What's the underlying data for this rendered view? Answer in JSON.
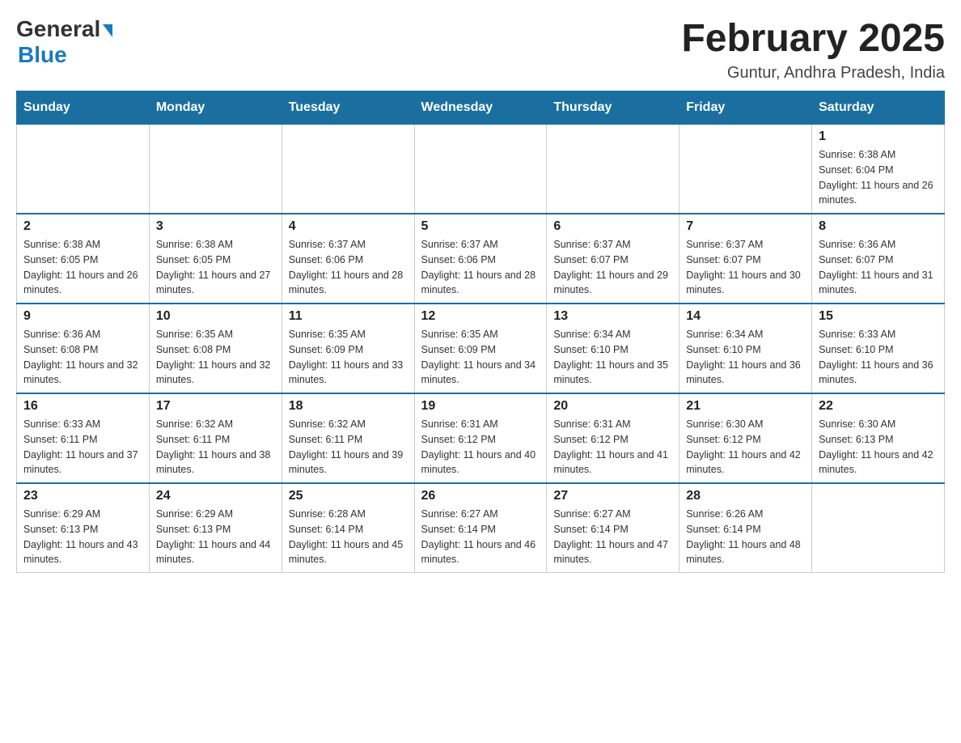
{
  "header": {
    "logo_general": "General",
    "logo_blue": "Blue",
    "month_title": "February 2025",
    "location": "Guntur, Andhra Pradesh, India"
  },
  "weekdays": [
    "Sunday",
    "Monday",
    "Tuesday",
    "Wednesday",
    "Thursday",
    "Friday",
    "Saturday"
  ],
  "weeks": [
    [
      {
        "day": "",
        "sunrise": "",
        "sunset": "",
        "daylight": ""
      },
      {
        "day": "",
        "sunrise": "",
        "sunset": "",
        "daylight": ""
      },
      {
        "day": "",
        "sunrise": "",
        "sunset": "",
        "daylight": ""
      },
      {
        "day": "",
        "sunrise": "",
        "sunset": "",
        "daylight": ""
      },
      {
        "day": "",
        "sunrise": "",
        "sunset": "",
        "daylight": ""
      },
      {
        "day": "",
        "sunrise": "",
        "sunset": "",
        "daylight": ""
      },
      {
        "day": "1",
        "sunrise": "Sunrise: 6:38 AM",
        "sunset": "Sunset: 6:04 PM",
        "daylight": "Daylight: 11 hours and 26 minutes."
      }
    ],
    [
      {
        "day": "2",
        "sunrise": "Sunrise: 6:38 AM",
        "sunset": "Sunset: 6:05 PM",
        "daylight": "Daylight: 11 hours and 26 minutes."
      },
      {
        "day": "3",
        "sunrise": "Sunrise: 6:38 AM",
        "sunset": "Sunset: 6:05 PM",
        "daylight": "Daylight: 11 hours and 27 minutes."
      },
      {
        "day": "4",
        "sunrise": "Sunrise: 6:37 AM",
        "sunset": "Sunset: 6:06 PM",
        "daylight": "Daylight: 11 hours and 28 minutes."
      },
      {
        "day": "5",
        "sunrise": "Sunrise: 6:37 AM",
        "sunset": "Sunset: 6:06 PM",
        "daylight": "Daylight: 11 hours and 28 minutes."
      },
      {
        "day": "6",
        "sunrise": "Sunrise: 6:37 AM",
        "sunset": "Sunset: 6:07 PM",
        "daylight": "Daylight: 11 hours and 29 minutes."
      },
      {
        "day": "7",
        "sunrise": "Sunrise: 6:37 AM",
        "sunset": "Sunset: 6:07 PM",
        "daylight": "Daylight: 11 hours and 30 minutes."
      },
      {
        "day": "8",
        "sunrise": "Sunrise: 6:36 AM",
        "sunset": "Sunset: 6:07 PM",
        "daylight": "Daylight: 11 hours and 31 minutes."
      }
    ],
    [
      {
        "day": "9",
        "sunrise": "Sunrise: 6:36 AM",
        "sunset": "Sunset: 6:08 PM",
        "daylight": "Daylight: 11 hours and 32 minutes."
      },
      {
        "day": "10",
        "sunrise": "Sunrise: 6:35 AM",
        "sunset": "Sunset: 6:08 PM",
        "daylight": "Daylight: 11 hours and 32 minutes."
      },
      {
        "day": "11",
        "sunrise": "Sunrise: 6:35 AM",
        "sunset": "Sunset: 6:09 PM",
        "daylight": "Daylight: 11 hours and 33 minutes."
      },
      {
        "day": "12",
        "sunrise": "Sunrise: 6:35 AM",
        "sunset": "Sunset: 6:09 PM",
        "daylight": "Daylight: 11 hours and 34 minutes."
      },
      {
        "day": "13",
        "sunrise": "Sunrise: 6:34 AM",
        "sunset": "Sunset: 6:10 PM",
        "daylight": "Daylight: 11 hours and 35 minutes."
      },
      {
        "day": "14",
        "sunrise": "Sunrise: 6:34 AM",
        "sunset": "Sunset: 6:10 PM",
        "daylight": "Daylight: 11 hours and 36 minutes."
      },
      {
        "day": "15",
        "sunrise": "Sunrise: 6:33 AM",
        "sunset": "Sunset: 6:10 PM",
        "daylight": "Daylight: 11 hours and 36 minutes."
      }
    ],
    [
      {
        "day": "16",
        "sunrise": "Sunrise: 6:33 AM",
        "sunset": "Sunset: 6:11 PM",
        "daylight": "Daylight: 11 hours and 37 minutes."
      },
      {
        "day": "17",
        "sunrise": "Sunrise: 6:32 AM",
        "sunset": "Sunset: 6:11 PM",
        "daylight": "Daylight: 11 hours and 38 minutes."
      },
      {
        "day": "18",
        "sunrise": "Sunrise: 6:32 AM",
        "sunset": "Sunset: 6:11 PM",
        "daylight": "Daylight: 11 hours and 39 minutes."
      },
      {
        "day": "19",
        "sunrise": "Sunrise: 6:31 AM",
        "sunset": "Sunset: 6:12 PM",
        "daylight": "Daylight: 11 hours and 40 minutes."
      },
      {
        "day": "20",
        "sunrise": "Sunrise: 6:31 AM",
        "sunset": "Sunset: 6:12 PM",
        "daylight": "Daylight: 11 hours and 41 minutes."
      },
      {
        "day": "21",
        "sunrise": "Sunrise: 6:30 AM",
        "sunset": "Sunset: 6:12 PM",
        "daylight": "Daylight: 11 hours and 42 minutes."
      },
      {
        "day": "22",
        "sunrise": "Sunrise: 6:30 AM",
        "sunset": "Sunset: 6:13 PM",
        "daylight": "Daylight: 11 hours and 42 minutes."
      }
    ],
    [
      {
        "day": "23",
        "sunrise": "Sunrise: 6:29 AM",
        "sunset": "Sunset: 6:13 PM",
        "daylight": "Daylight: 11 hours and 43 minutes."
      },
      {
        "day": "24",
        "sunrise": "Sunrise: 6:29 AM",
        "sunset": "Sunset: 6:13 PM",
        "daylight": "Daylight: 11 hours and 44 minutes."
      },
      {
        "day": "25",
        "sunrise": "Sunrise: 6:28 AM",
        "sunset": "Sunset: 6:14 PM",
        "daylight": "Daylight: 11 hours and 45 minutes."
      },
      {
        "day": "26",
        "sunrise": "Sunrise: 6:27 AM",
        "sunset": "Sunset: 6:14 PM",
        "daylight": "Daylight: 11 hours and 46 minutes."
      },
      {
        "day": "27",
        "sunrise": "Sunrise: 6:27 AM",
        "sunset": "Sunset: 6:14 PM",
        "daylight": "Daylight: 11 hours and 47 minutes."
      },
      {
        "day": "28",
        "sunrise": "Sunrise: 6:26 AM",
        "sunset": "Sunset: 6:14 PM",
        "daylight": "Daylight: 11 hours and 48 minutes."
      },
      {
        "day": "",
        "sunrise": "",
        "sunset": "",
        "daylight": ""
      }
    ]
  ]
}
